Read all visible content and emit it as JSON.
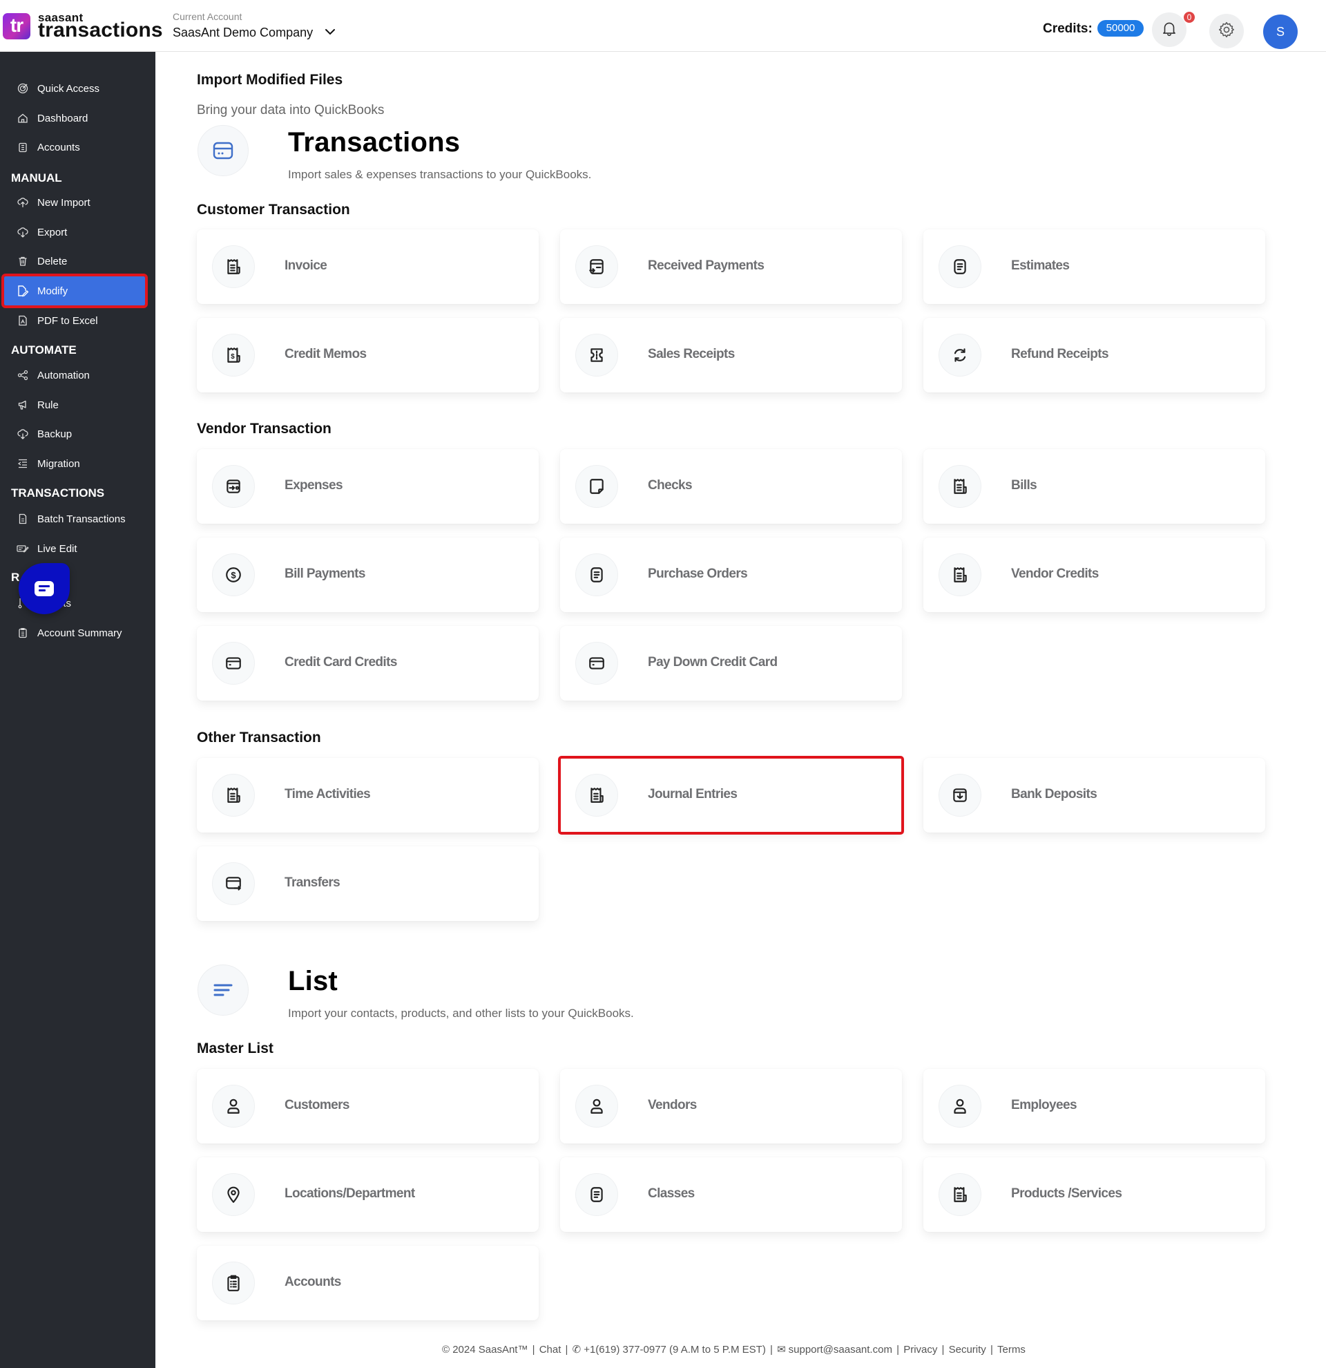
{
  "header": {
    "logo_mark": "tr",
    "logo_brand": "saasant",
    "logo_product": "transactions",
    "account_label": "Current Account",
    "account_name": "SaasAnt Demo Company",
    "credits_label": "Credits:",
    "credits_value": "50000",
    "notification_count": "0",
    "avatar_initial": "S"
  },
  "sidebar": {
    "top_items": [
      {
        "label": "Quick Access",
        "icon": "target-icon"
      },
      {
        "label": "Dashboard",
        "icon": "home-icon"
      },
      {
        "label": "Accounts",
        "icon": "clipboard-icon"
      }
    ],
    "sections": [
      {
        "title": "MANUAL",
        "items": [
          {
            "label": "New Import",
            "icon": "cloud-upload-icon"
          },
          {
            "label": "Export",
            "icon": "cloud-download-icon"
          },
          {
            "label": "Delete",
            "icon": "trash-icon"
          },
          {
            "label": "Modify",
            "icon": "file-edit-icon",
            "active": true
          },
          {
            "label": "PDF to Excel",
            "icon": "pdf-file-icon"
          }
        ]
      },
      {
        "title": "AUTOMATE",
        "items": [
          {
            "label": "Automation",
            "icon": "share-nodes-icon"
          },
          {
            "label": "Rule",
            "icon": "megaphone-icon"
          },
          {
            "label": "Backup",
            "icon": "cloud-download-icon"
          },
          {
            "label": "Migration",
            "icon": "list-indent-icon"
          }
        ]
      },
      {
        "title": "TRANSACTIONS",
        "items": [
          {
            "label": "Batch Transactions",
            "icon": "document-icon"
          },
          {
            "label": "Live Edit",
            "icon": "edit-lines-icon"
          }
        ]
      },
      {
        "title": "R",
        "items": [
          {
            "label": "its",
            "icon": "pin-icon"
          },
          {
            "label": "Account Summary",
            "icon": "clipboard-icon"
          }
        ]
      }
    ]
  },
  "main": {
    "page_title": "Import Modified Files",
    "page_subtitle": "Bring your data into QuickBooks",
    "transactions": {
      "title": "Transactions",
      "description": "Import sales & expenses transactions to your QuickBooks.",
      "groups": [
        {
          "title": "Customer Transaction",
          "cards": [
            {
              "label": "Invoice",
              "icon": "receipt-icon"
            },
            {
              "label": "Received Payments",
              "icon": "card-arrow-icon"
            },
            {
              "label": "Estimates",
              "icon": "document-lines-icon"
            },
            {
              "label": "Credit Memos",
              "icon": "receipt-dollar-icon"
            },
            {
              "label": "Sales Receipts",
              "icon": "ticket-icon"
            },
            {
              "label": "Refund Receipts",
              "icon": "refresh-icon"
            }
          ]
        },
        {
          "title": "Vendor Transaction",
          "cards": [
            {
              "label": "Expenses",
              "icon": "wallet-arrow-icon"
            },
            {
              "label": "Checks",
              "icon": "note-icon"
            },
            {
              "label": "Bills",
              "icon": "receipt-icon"
            },
            {
              "label": "Bill Payments",
              "icon": "dollar-circle-icon"
            },
            {
              "label": "Purchase Orders",
              "icon": "document-lines-icon"
            },
            {
              "label": "Vendor Credits",
              "icon": "receipt-icon"
            },
            {
              "label": "Credit Card Credits",
              "icon": "credit-card-icon"
            },
            {
              "label": "Pay Down Credit Card",
              "icon": "credit-card-icon"
            }
          ]
        },
        {
          "title": "Other Transaction",
          "cards": [
            {
              "label": "Time Activities",
              "icon": "receipt-icon"
            },
            {
              "label": "Journal Entries",
              "icon": "receipt-icon",
              "highlighted": true
            },
            {
              "label": "Bank Deposits",
              "icon": "deposit-icon"
            },
            {
              "label": "Transfers",
              "icon": "card-transfer-icon"
            }
          ]
        }
      ]
    },
    "list": {
      "title": "List",
      "description": "Import your contacts, products, and other lists to your QuickBooks.",
      "groups": [
        {
          "title": "Master List",
          "cards": [
            {
              "label": "Customers",
              "icon": "user-icon"
            },
            {
              "label": "Vendors",
              "icon": "user-icon"
            },
            {
              "label": "Employees",
              "icon": "user-icon"
            },
            {
              "label": "Locations/Department",
              "icon": "location-pin-icon"
            },
            {
              "label": "Classes",
              "icon": "document-lines-icon"
            },
            {
              "label": "Products /Services",
              "icon": "receipt-icon"
            },
            {
              "label": "Accounts",
              "icon": "clipboard-icon"
            }
          ]
        }
      ]
    }
  },
  "footer": {
    "copyright": "© 2024 SaasAnt™",
    "chat": "Chat",
    "phone": "+1(619) 377-0977 (9 A.M to 5 P.M EST)",
    "email": "support@saasant.com",
    "privacy": "Privacy",
    "security": "Security",
    "terms": "Terms"
  },
  "colors": {
    "sidebar_bg": "#272a30",
    "active_item": "#3a6fe0",
    "highlight_border": "#e0141c",
    "credits_badge": "#1e7be6",
    "avatar": "#2f6bdb",
    "chat_bubble": "#0a0fc2"
  }
}
